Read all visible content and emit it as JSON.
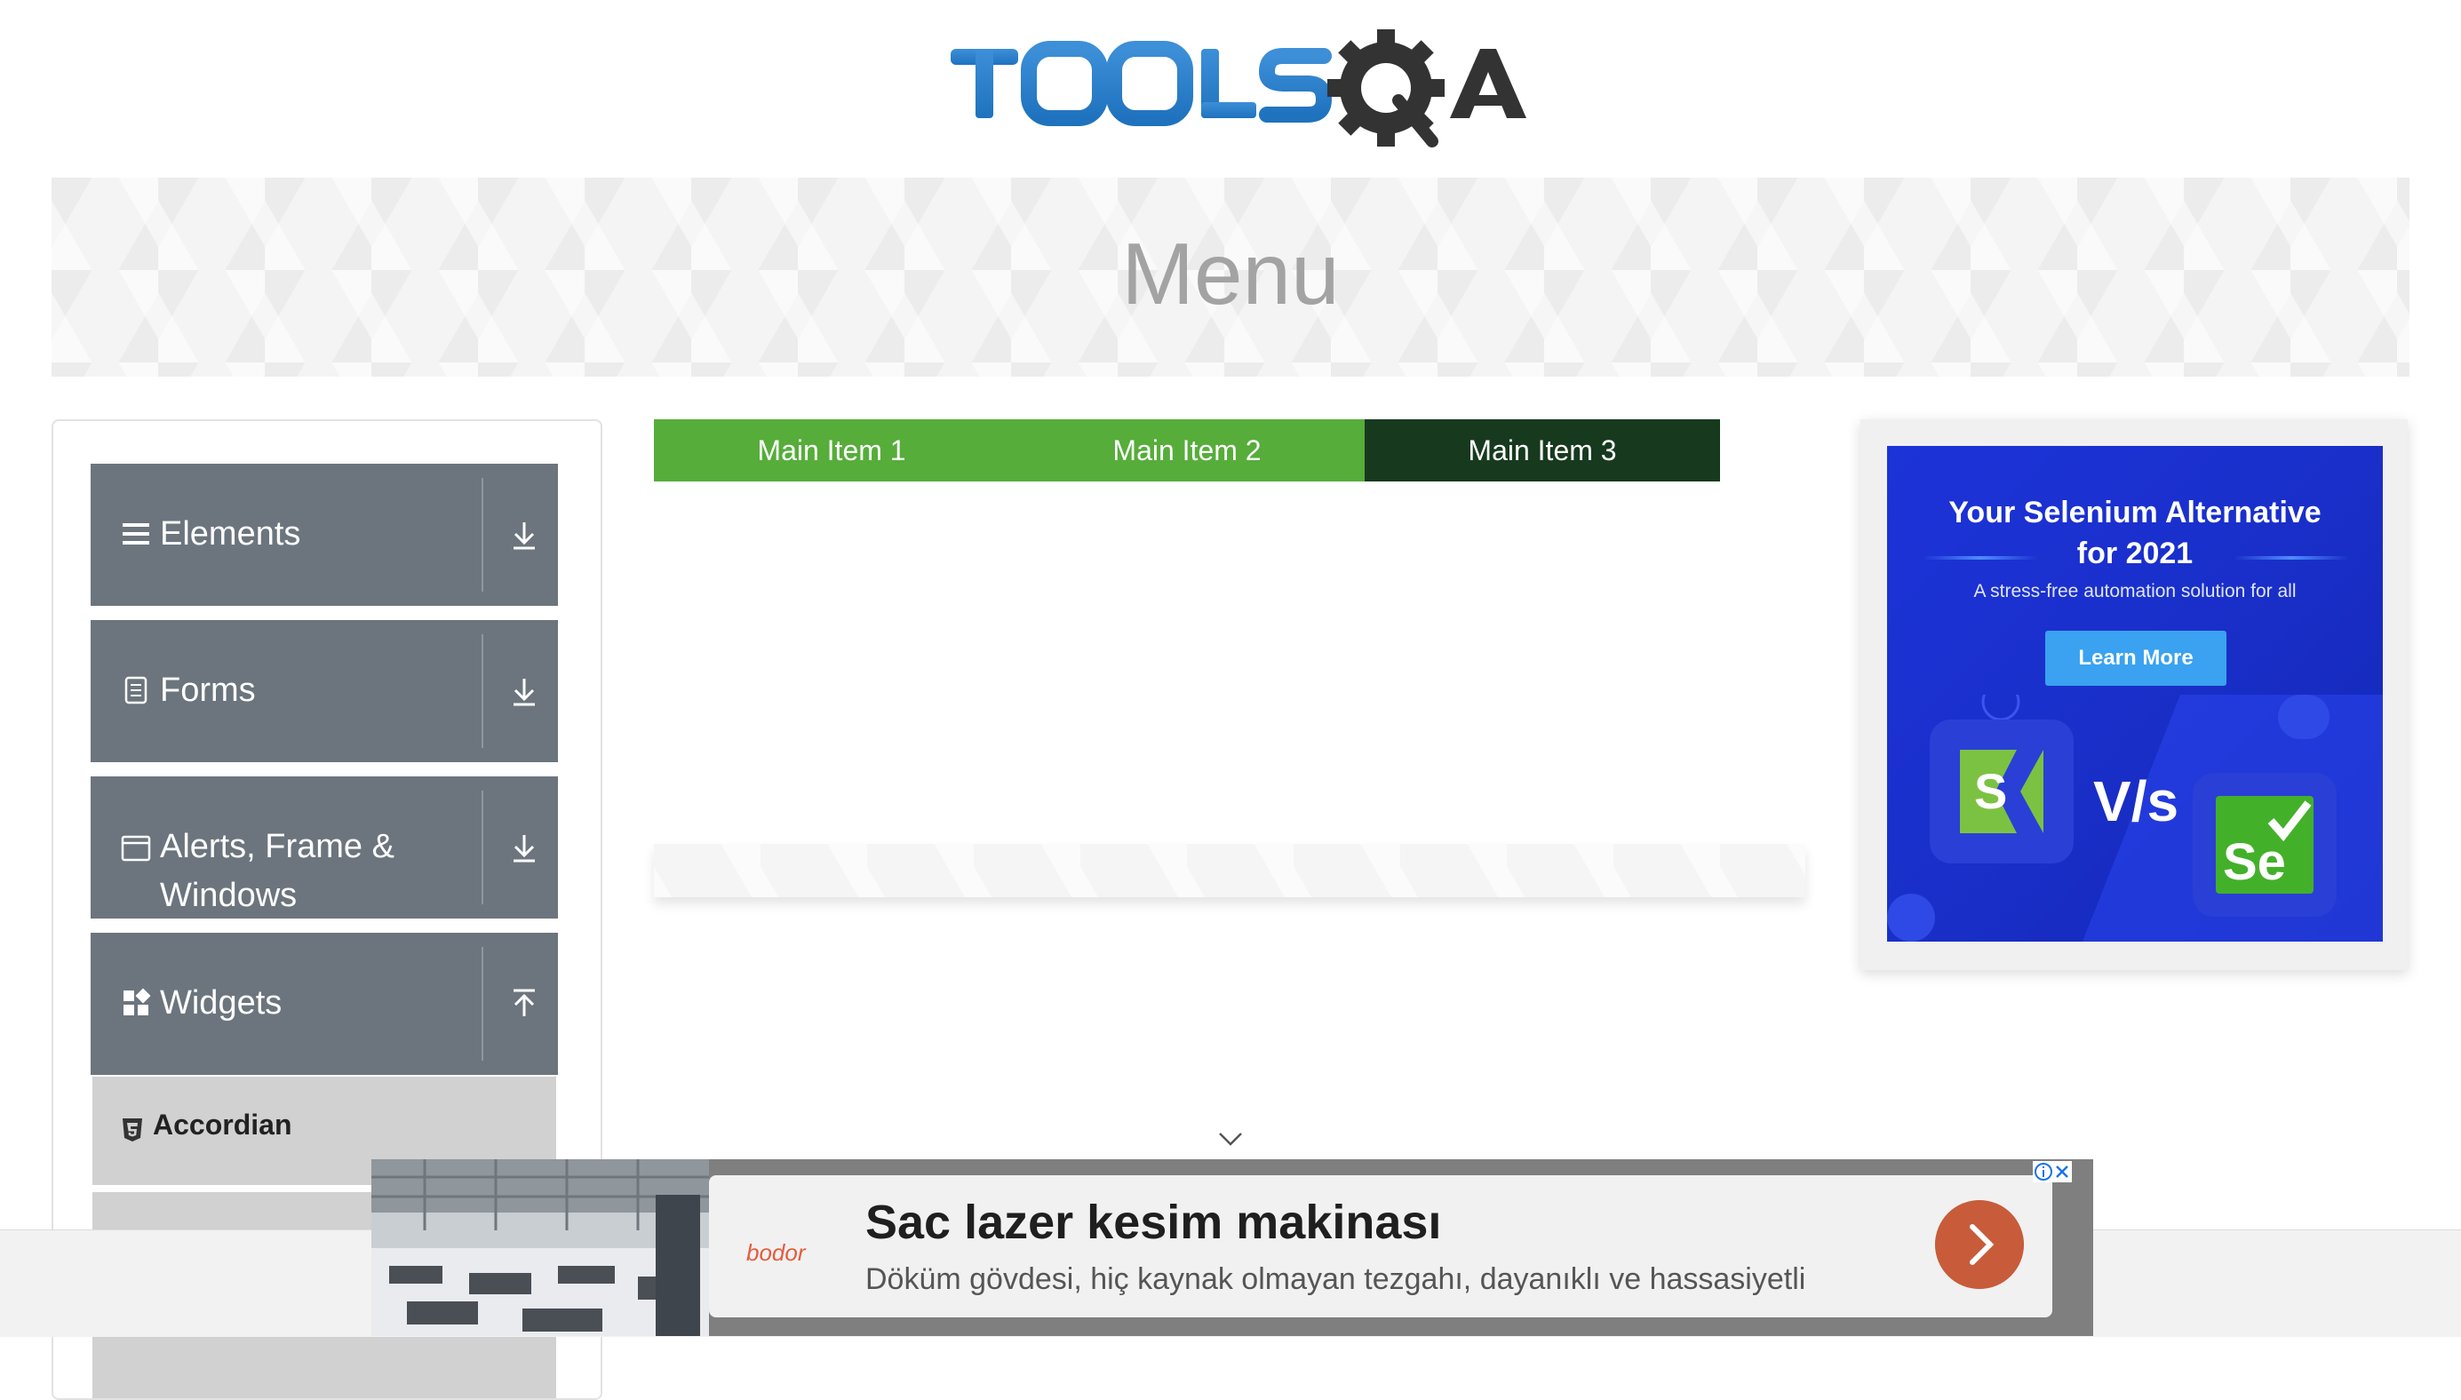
{
  "header": {
    "logo_text": "TOOLSQA"
  },
  "banner": {
    "title": "Menu"
  },
  "sidebar": {
    "groups": [
      {
        "label": "Elements",
        "icon": "hamburger-icon",
        "arrow": "download-arrow-icon"
      },
      {
        "label": "Forms",
        "icon": "document-icon",
        "arrow": "download-arrow-icon"
      },
      {
        "label_line1": "Alerts, Frame &",
        "label_line2": "Windows",
        "icon": "window-icon",
        "arrow": "download-arrow-icon"
      },
      {
        "label": "Widgets",
        "icon": "widgets-icon",
        "arrow": "upload-arrow-icon"
      }
    ],
    "items": [
      {
        "label": "Accordian",
        "icon": "html5-icon"
      }
    ]
  },
  "menu": {
    "items": [
      {
        "label": "Main Item 1"
      },
      {
        "label": "Main Item 2"
      },
      {
        "label": "Main Item 3"
      }
    ]
  },
  "right_ad": {
    "title_line1": "Your Selenium Alternative",
    "title_line2": "for 2021",
    "subtitle": "A stress-free automation solution for all",
    "cta": "Learn More",
    "vs_text": "V/s",
    "logo_left": "S",
    "logo_right": "Se"
  },
  "bottom_ad": {
    "brand": "bodor",
    "headline": "Sac lazer kesim makinası",
    "description": "Döküm gövdesi, hiç kaynak olmayan tezgahı, dayanıklı ve hassasiyetli"
  },
  "colors": {
    "menu_green": "#56ad3a",
    "menu_dark_green": "#173a1f",
    "sidebar_group_bg": "#6c757d",
    "ad_blue": "#1c33d9",
    "cta_blue": "#3aa2f0",
    "ad_go_button": "#c85c3a"
  }
}
